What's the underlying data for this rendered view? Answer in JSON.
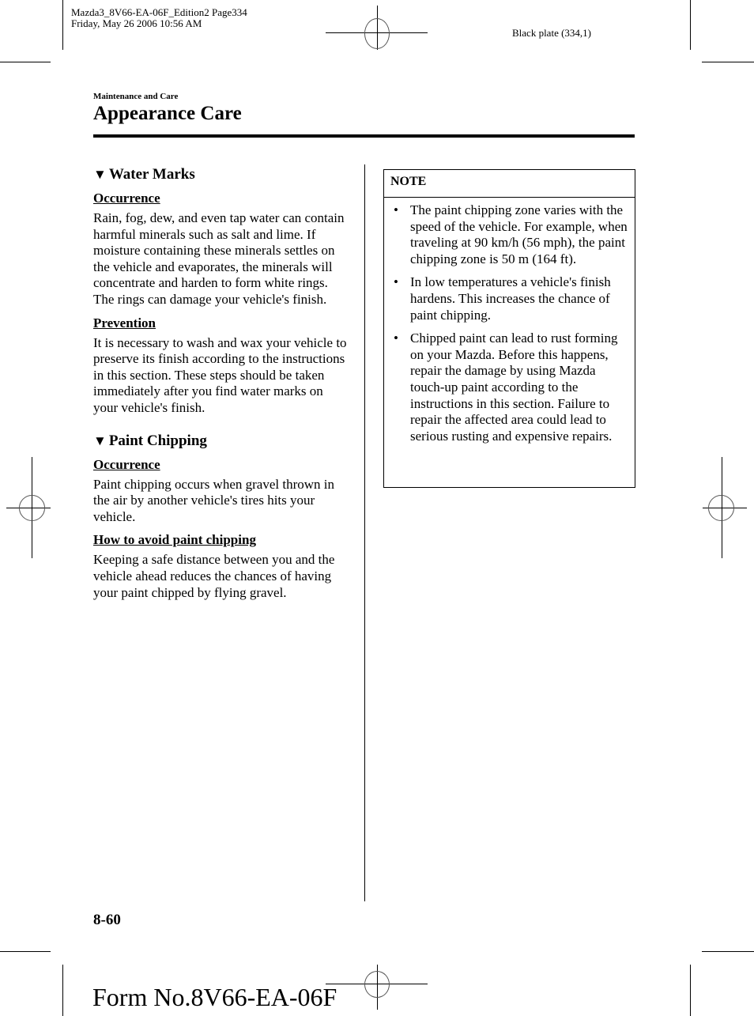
{
  "print_header": {
    "file_line": "Mazda3_8V66-EA-06F_Edition2 Page334",
    "date_line": "Friday, May 26 2006 10:56 AM",
    "plate": "Black plate (334,1)"
  },
  "section": {
    "category": "Maintenance and Care",
    "title": "Appearance Care"
  },
  "left_column": {
    "water_marks": {
      "heading": "Water Marks",
      "occurrence_label": "Occurrence",
      "occurrence_text": "Rain, fog, dew, and even tap water can contain harmful minerals such as salt and lime. If moisture containing these minerals settles on the vehicle and evaporates, the minerals will concentrate and harden to form white rings. The rings can damage your vehicle's finish.",
      "prevention_label": "Prevention",
      "prevention_text": "It is necessary to wash and wax your vehicle to preserve its finish according to the instructions in this section. These steps should be taken immediately after you find water marks on your vehicle's finish."
    },
    "paint_chipping": {
      "heading": "Paint Chipping",
      "occurrence_label": "Occurrence",
      "occurrence_text": "Paint chipping occurs when gravel thrown in the air by another vehicle's tires hits your vehicle.",
      "avoid_label": "How to avoid paint chipping",
      "avoid_text": "Keeping a safe distance between you and the vehicle ahead reduces the chances of having your paint chipped by flying gravel."
    }
  },
  "note": {
    "heading": "NOTE",
    "bullet_glyph": "•",
    "items": [
      "The paint chipping zone varies with the speed of the vehicle. For example, when traveling at 90 km/h (56 mph), the paint chipping zone is 50 m (164 ft).",
      "In low temperatures a vehicle's finish hardens. This increases the chance of paint chipping.",
      "Chipped paint can lead to rust forming on your Mazda. Before this happens, repair the damage by using Mazda touch-up paint according to the instructions in this section. Failure to repair the affected area could lead to serious rusting and expensive repairs."
    ]
  },
  "footer": {
    "page_number": "8-60",
    "form_number": "Form No.8V66-EA-06F"
  },
  "icons": {
    "heading_marker": "▼"
  }
}
